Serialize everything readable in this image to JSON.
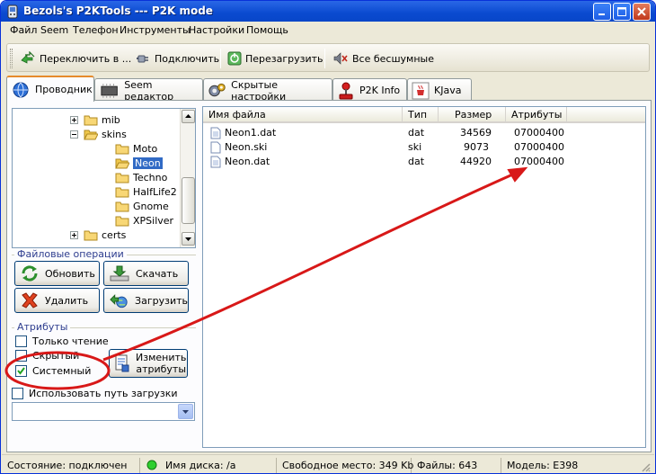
{
  "window": {
    "title": "Bezols's P2KTools --- P2K mode"
  },
  "menu": [
    "Файл",
    "Seem",
    "Телефон",
    "Инструменты",
    "Настройки",
    "Помощь"
  ],
  "toolbar": {
    "switch_label": "Переключить в ...",
    "connect_label": "Подключить",
    "restart_label": "Перезагрузить",
    "silent_label": "Все бесшумные"
  },
  "tabs": [
    "Проводник",
    "Seem редактор",
    "Скрытые настройки",
    "P2K Info",
    "KJava"
  ],
  "tree": {
    "items": [
      {
        "label": "mib"
      },
      {
        "label": "skins"
      },
      {
        "label": "Moto"
      },
      {
        "label": "Neon"
      },
      {
        "label": "Techno"
      },
      {
        "label": "HalfLife2"
      },
      {
        "label": "Gnome"
      },
      {
        "label": "XPSilver"
      },
      {
        "label": "certs"
      }
    ]
  },
  "file_ops": {
    "group_title": "Файловые операции",
    "refresh_label": "Обновить",
    "download_label": "Скачать",
    "delete_label": "Удалить",
    "upload_label": "Загрузить"
  },
  "attributes": {
    "group_title": "Атрибуты",
    "readonly_label": "Только чтение",
    "hidden_label": "Скрытый",
    "system_label": "Системный",
    "change_label_1": "Изменить",
    "change_label_2": "атрибуты"
  },
  "load_path": {
    "label": "Использовать путь загрузки",
    "value": ""
  },
  "file_list": {
    "columns": [
      "Имя файла",
      "Тип",
      "Размер",
      "Атрибуты"
    ],
    "rows": [
      {
        "name": "Neon1.dat",
        "type": "dat",
        "size": "34569",
        "attr": "07000400"
      },
      {
        "name": "Neon.ski",
        "type": "ski",
        "size": "9073",
        "attr": "07000400"
      },
      {
        "name": "Neon.dat",
        "type": "dat",
        "size": "44920",
        "attr": "07000400"
      }
    ]
  },
  "status": {
    "state": "Состояние: подключен",
    "disk": "Имя диска: /a",
    "free": "Свободное место: 349 Kb",
    "files": "Файлы: 643",
    "model": "Модель: E398"
  },
  "colors": {
    "annotation": "#d81818",
    "title_bar": "#0a4ad0",
    "selection": "#316ac5"
  }
}
